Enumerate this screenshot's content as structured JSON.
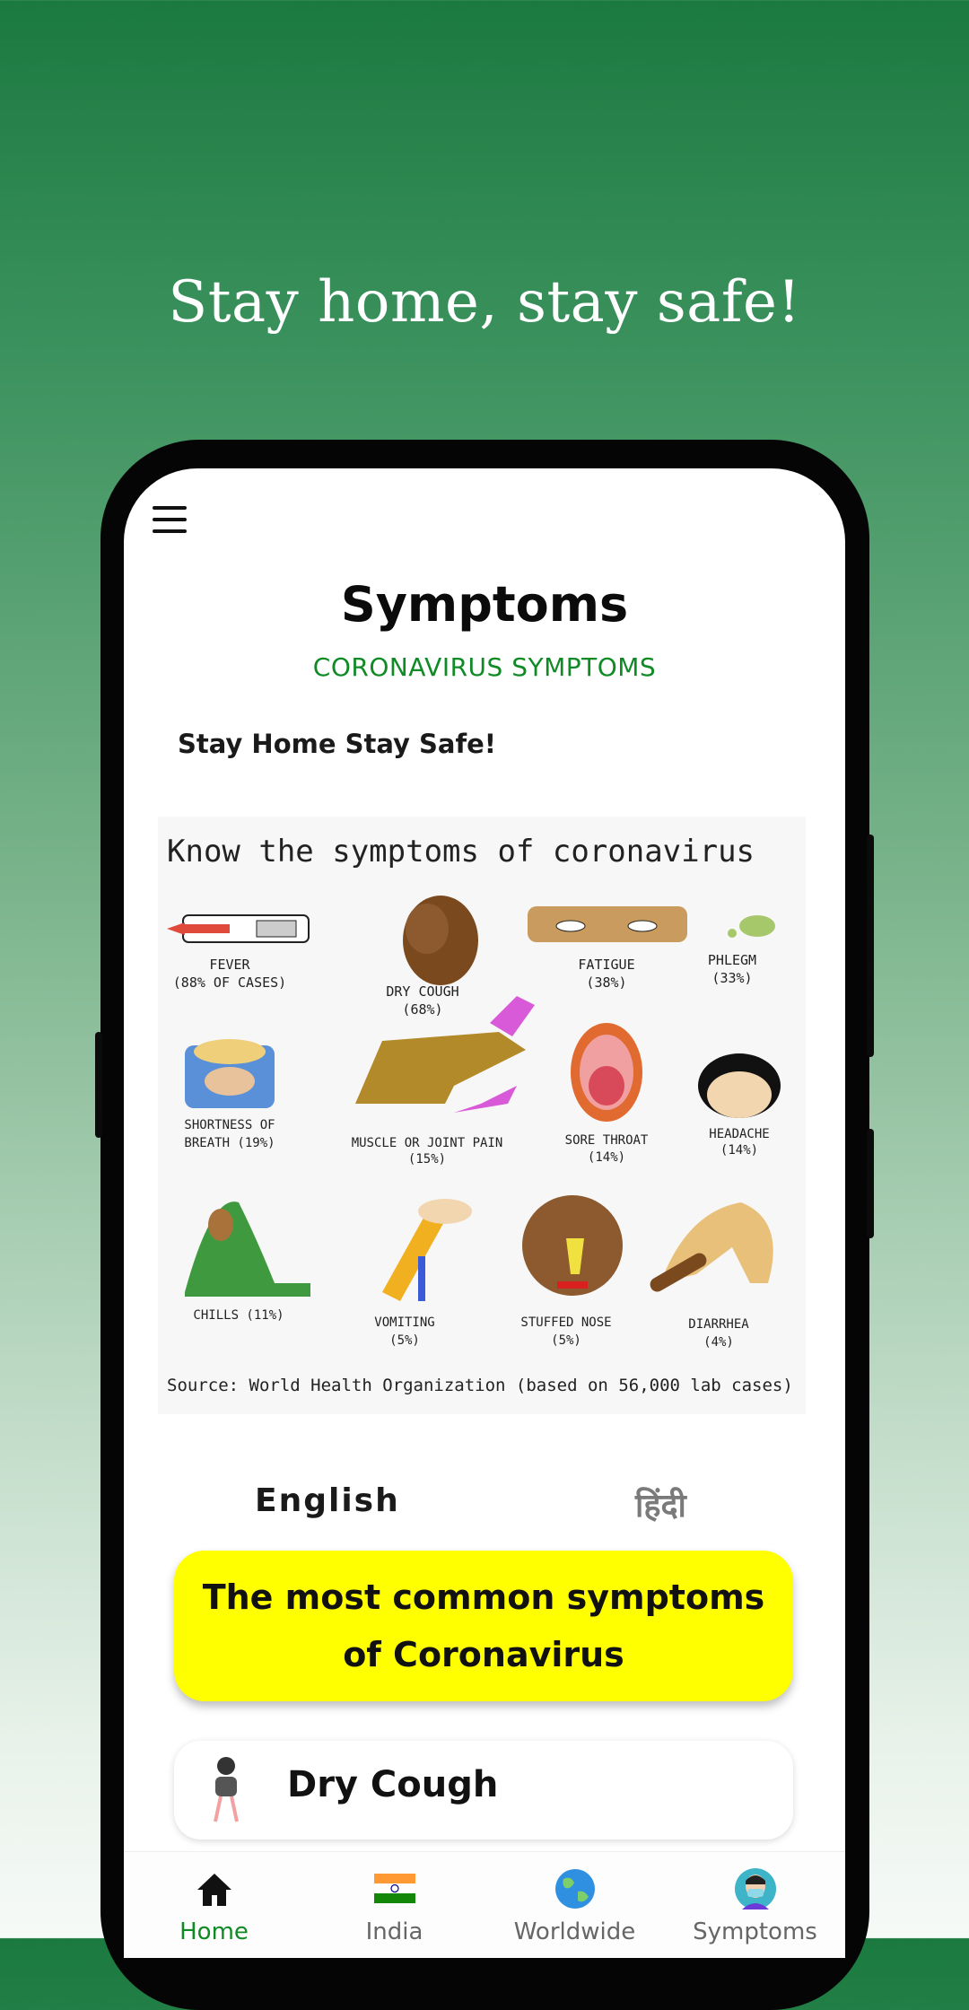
{
  "tagline": "Stay home, stay safe!",
  "app": {
    "title": "Symptoms",
    "subtitle": "CORONAVIRUS SYMPTOMS",
    "greeting": "Stay Home Stay Safe!"
  },
  "poster": {
    "heading": "Know the symptoms of coronavirus",
    "items": [
      {
        "name": "FEVER",
        "stat": "(88% OF CASES)"
      },
      {
        "name": "DRY COUGH",
        "stat": "(68%)"
      },
      {
        "name": "FATIGUE",
        "stat": "(38%)"
      },
      {
        "name": "PHLEGM",
        "stat": "(33%)"
      },
      {
        "name": "SHORTNESS OF",
        "stat": "BREATH (19%)"
      },
      {
        "name": "MUSCLE OR JOINT PAIN",
        "stat": "(15%)"
      },
      {
        "name": "SORE THROAT",
        "stat": "(14%)"
      },
      {
        "name": "HEADACHE",
        "stat": "(14%)"
      },
      {
        "name": "CHILLS (11%)",
        "stat": ""
      },
      {
        "name": "VOMITING",
        "stat": "(5%)"
      },
      {
        "name": "STUFFED NOSE",
        "stat": "(5%)"
      },
      {
        "name": "DIARRHEA",
        "stat": "(4%)"
      }
    ],
    "source": "Source: World Health Organization (based on 56,000 lab cases)"
  },
  "language": {
    "english": "English",
    "hindi": "हिंदी"
  },
  "banner": {
    "text": "The most common symptoms of Coronavirus"
  },
  "symptom_card": {
    "label": "Dry Cough"
  },
  "bottom_nav": [
    {
      "label": "Home",
      "icon": "home-icon",
      "active": true
    },
    {
      "label": "India",
      "icon": "india-flag-icon",
      "active": false
    },
    {
      "label": "Worldwide",
      "icon": "globe-icon",
      "active": false
    },
    {
      "label": "Symptoms",
      "icon": "masked-person-icon",
      "active": false
    }
  ],
  "colors": {
    "accent_green": "#0f8a25",
    "banner_yellow": "#ffff00",
    "bg_top": "#1b7a40"
  }
}
